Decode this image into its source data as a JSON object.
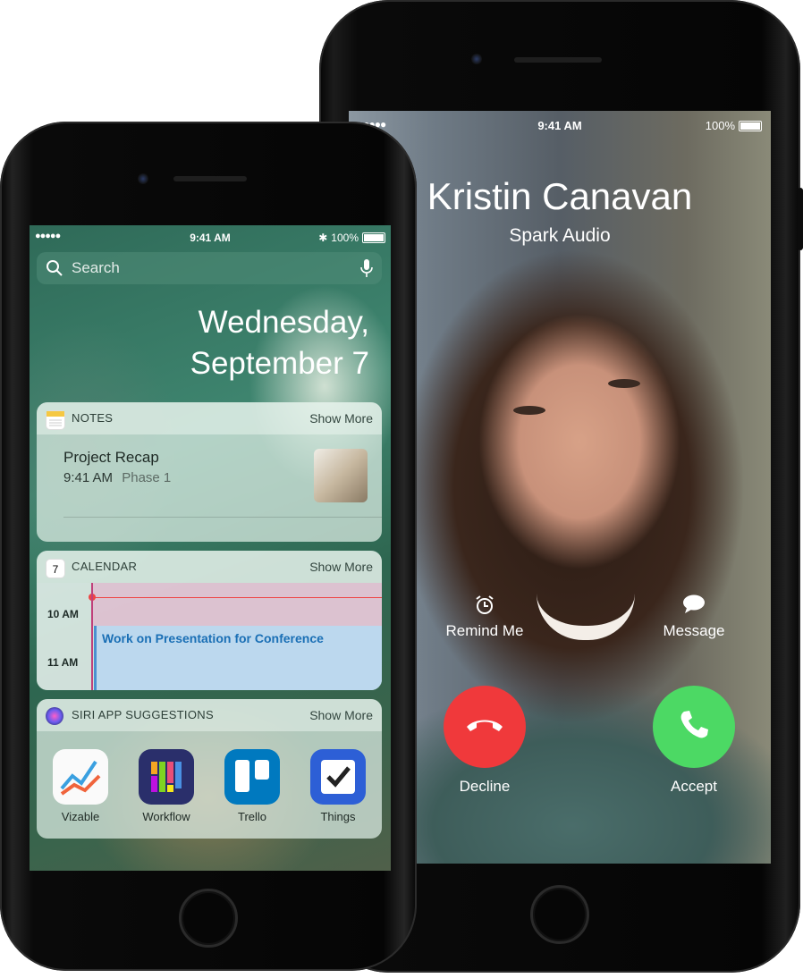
{
  "back_phone": {
    "status": {
      "signal": "●●●●●",
      "time": "9:41 AM",
      "battery": "100%"
    },
    "caller": {
      "name": "Kristin Canavan",
      "subtitle": "Spark Audio"
    },
    "options": [
      {
        "label": "Remind Me",
        "icon": "alarm-clock-icon"
      },
      {
        "label": "Message",
        "icon": "speech-bubble-icon"
      }
    ],
    "actions": {
      "decline": {
        "label": "Decline",
        "color": "#f0393b"
      },
      "accept": {
        "label": "Accept",
        "color": "#4cd964"
      }
    }
  },
  "front_phone": {
    "status": {
      "signal": "●●●●●",
      "time": "9:41 AM",
      "battery": "100%"
    },
    "search": {
      "placeholder": "Search"
    },
    "date": {
      "line1": "Wednesday,",
      "line2": "September 7"
    },
    "notes_widget": {
      "title": "NOTES",
      "show_more": "Show More",
      "note_title": "Project Recap",
      "note_time": "9:41 AM",
      "note_detail": "Phase 1"
    },
    "calendar_widget": {
      "title": "CALENDAR",
      "show_more": "Show More",
      "icon_day": "7",
      "times": [
        "10 AM",
        "11 AM"
      ],
      "event": "Work on Presentation for Conference",
      "event_color": "#1a6fb5"
    },
    "siri_widget": {
      "title": "SIRI APP SUGGESTIONS",
      "show_more": "Show More",
      "apps": [
        {
          "name": "Vizable",
          "icon": "vizable-app-icon"
        },
        {
          "name": "Workflow",
          "icon": "workflow-app-icon"
        },
        {
          "name": "Trello",
          "icon": "trello-app-icon"
        },
        {
          "name": "Things",
          "icon": "things-app-icon"
        }
      ]
    }
  }
}
